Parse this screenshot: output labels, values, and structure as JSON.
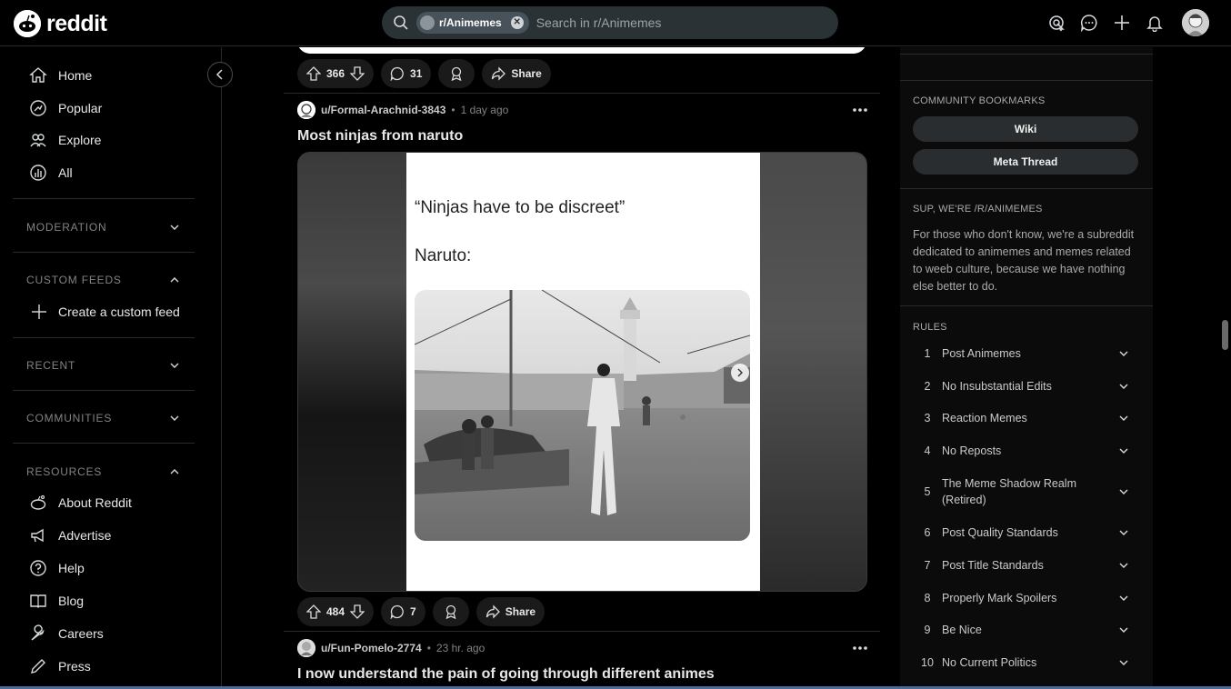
{
  "header": {
    "logo_text": "reddit",
    "search_chip": "r/Animemes",
    "search_placeholder": "Search in r/Animemes",
    "icons": [
      "advertise-icon",
      "chat-icon",
      "create-icon",
      "notifications-icon",
      "avatar"
    ]
  },
  "sidebar": {
    "nav": [
      {
        "label": "Home",
        "icon": "home-icon"
      },
      {
        "label": "Popular",
        "icon": "popular-icon"
      },
      {
        "label": "Explore",
        "icon": "explore-icon"
      },
      {
        "label": "All",
        "icon": "all-icon"
      }
    ],
    "sections": {
      "moderation": "MODERATION",
      "custom_feeds": "CUSTOM FEEDS",
      "create_custom_feed": "Create a custom feed",
      "recent": "RECENT",
      "communities": "COMMUNITIES",
      "resources": "RESOURCES"
    },
    "resources": [
      {
        "label": "About Reddit",
        "icon": "reddit-alien-icon"
      },
      {
        "label": "Advertise",
        "icon": "megaphone-icon"
      },
      {
        "label": "Help",
        "icon": "help-icon"
      },
      {
        "label": "Blog",
        "icon": "book-icon"
      },
      {
        "label": "Careers",
        "icon": "wrench-icon"
      },
      {
        "label": "Press",
        "icon": "pencil-icon"
      }
    ]
  },
  "feed": {
    "prev_post": {
      "votes": "366",
      "comments": "31",
      "share": "Share"
    },
    "post": {
      "user": "u/Formal-Arachnid-3843",
      "time": "1 day ago",
      "title": "Most ninjas from naruto",
      "meme_line1": "“Ninjas have to be discreet”",
      "meme_line2": "Naruto:",
      "votes": "484",
      "comments": "7",
      "share": "Share"
    },
    "next_post": {
      "user": "u/Fun-Pomelo-2774",
      "time": "23 hr. ago",
      "title": "I now understand the pain of going through different animes"
    }
  },
  "right_sidebar": {
    "bookmarks_heading": "COMMUNITY BOOKMARKS",
    "bookmarks": [
      "Wiki",
      "Meta Thread"
    ],
    "about_heading": "SUP, WE'RE /R/ANIMEMES",
    "about_text": "For those who don't know, we're a subreddit dedicated to animemes and memes related to weeb culture, because we have nothing else better to do.",
    "rules_heading": "RULES",
    "rules": [
      {
        "num": "1",
        "text": "Post Animemes"
      },
      {
        "num": "2",
        "text": "No Insubstantial Edits"
      },
      {
        "num": "3",
        "text": "Reaction Memes"
      },
      {
        "num": "4",
        "text": "No Reposts"
      },
      {
        "num": "5",
        "text": "The Meme Shadow Realm (Retired)"
      },
      {
        "num": "6",
        "text": "Post Quality Standards"
      },
      {
        "num": "7",
        "text": "Post Title Standards"
      },
      {
        "num": "8",
        "text": "Properly Mark Spoilers"
      },
      {
        "num": "9",
        "text": "Be Nice"
      },
      {
        "num": "10",
        "text": "No Current Politics"
      }
    ]
  }
}
